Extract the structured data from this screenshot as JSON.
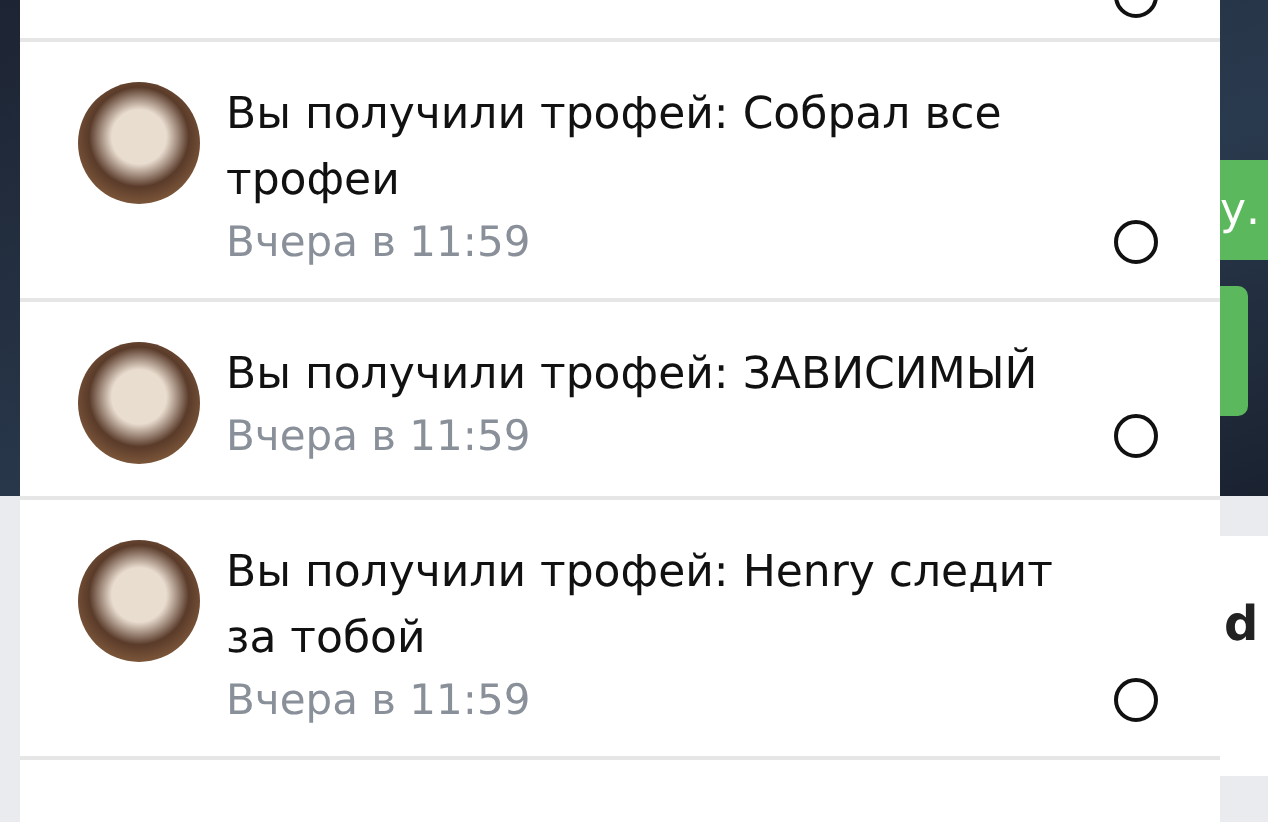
{
  "background": {
    "banner_text": "у.",
    "heading_text": "d"
  },
  "notifications": [
    {
      "title": "Вы получили трофей: Собрал все трофеи",
      "time": "Вчера в 11:59",
      "read": false
    },
    {
      "title": "Вы получили трофей: ЗАВИСИМЫЙ",
      "time": "Вчера в 11:59",
      "read": false
    },
    {
      "title": "Вы получили трофей: Henry следит за тобой",
      "time": "Вчера в 11:59",
      "read": false
    }
  ]
}
